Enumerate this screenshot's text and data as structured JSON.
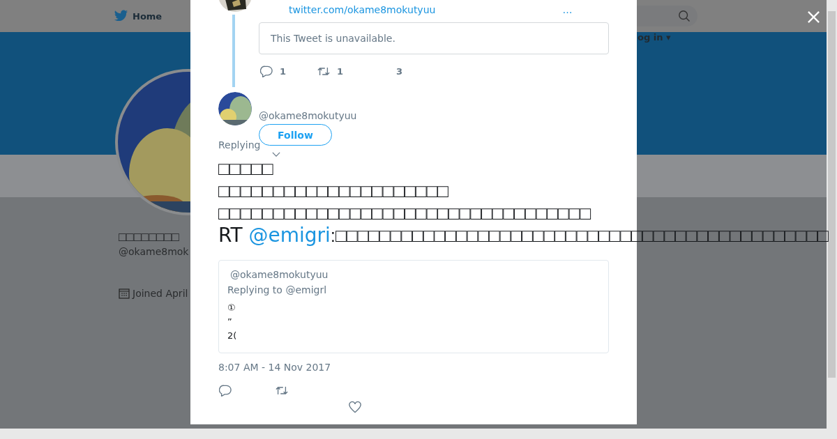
{
  "page": {
    "nav": {
      "home": "Home"
    },
    "login": "og in ▾",
    "profile": {
      "name": "□□□□□□□□",
      "handle": "@okame8mok",
      "joined": "Joined April"
    }
  },
  "modal": {
    "previous_tweet": {
      "link": "twitter.com/okame8mokutyuu",
      "more": "…",
      "quote_notice": "This Tweet is unavailable.",
      "replies": "1",
      "retweets": "1",
      "likes": "3"
    },
    "tweet": {
      "handle": "@okame8mokutyuu",
      "follow": "Follow",
      "replying": "Replying",
      "lines": [
        "□□□□□",
        "□□□□□□□□□□□□□□□□□□□□□",
        "□□□□□□□□□□□□□□□□□□□□□□□□□□□□□□□□□□"
      ],
      "retweet_prefix": "RT ",
      "retweet_mention": "@emigri",
      "retweet_text": ":□□□□□□□□□□□□□□□□□□□□□□□□□□□□□□□□□□□□□□□□□□□□□",
      "quote": {
        "handle": "@okame8mokutyuu",
        "replying": "Replying to @emigrl",
        "lines": [
          "①",
          "”",
          "2("
        ]
      },
      "timestamp": "8:07 AM - 14 Nov 2017"
    }
  }
}
